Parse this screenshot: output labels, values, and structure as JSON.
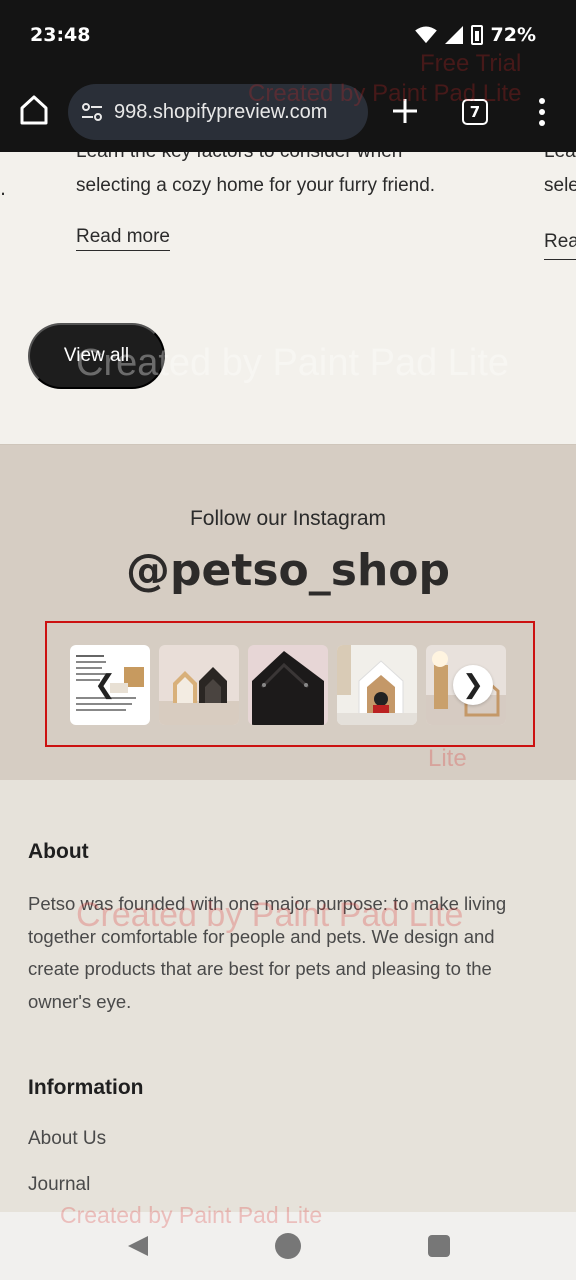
{
  "status_bar": {
    "time": "23:48",
    "battery": "72%"
  },
  "browser": {
    "url": "998.shopifypreview.com",
    "tab_count": "7"
  },
  "watermarks": {
    "trial": "Free Trial",
    "created_by": "Created by Paint Pad Lite",
    "lite": "Lite"
  },
  "blog": {
    "partial_line": "Learn the key factors to consider when",
    "line2": "selecting a cozy home for your furry friend.",
    "read_more": "Read more",
    "next_card_line1": "Lea",
    "next_card_line2": "sele",
    "next_card_read_more": "Rea",
    "view_all": "View all"
  },
  "instagram": {
    "kicker": "Follow our Instagram",
    "handle": "@petso_shop",
    "prev_arrow": "❮",
    "next_arrow": "❯",
    "highlight_color": "#cc1111"
  },
  "footer": {
    "about_heading": "About",
    "about_text": "Petso was founded with one major purpose: to make living together comfortable for people and pets. We design and create products that are best for pets and pleasing to the owner's eye.",
    "information_heading": "Information",
    "links": [
      "About Us",
      "Journal"
    ]
  }
}
